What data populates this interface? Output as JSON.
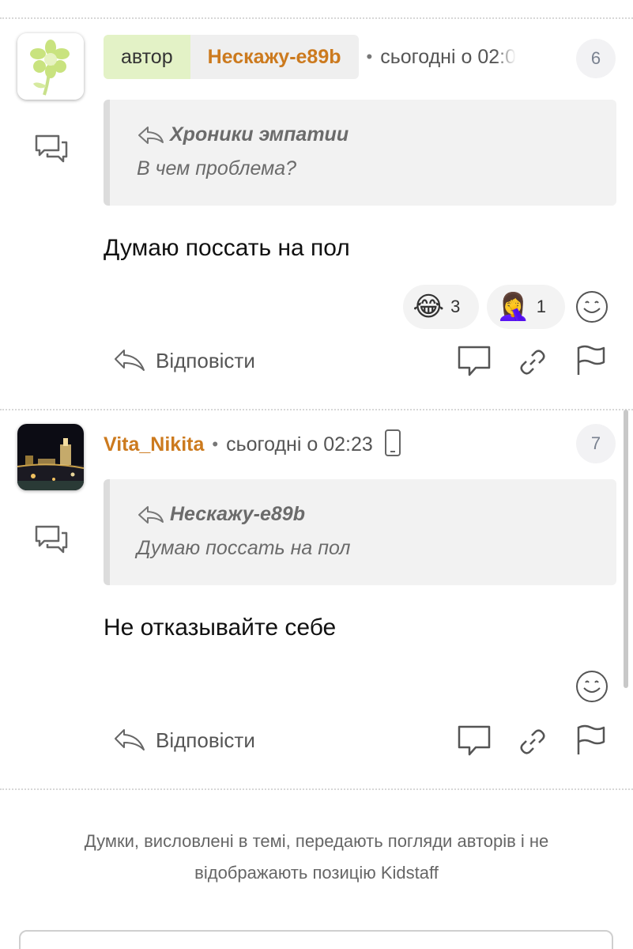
{
  "posts": [
    {
      "author_tag": "автор",
      "author": "Нескажу-e89b",
      "time": "сьогодні о 02:0",
      "number": "6",
      "quote": {
        "author": "Хроники эмпатии",
        "text": "В чем проблема?"
      },
      "body": "Думаю поссать на пол",
      "reactions": [
        {
          "emoji": "😂",
          "count": "3"
        },
        {
          "emoji": "🤦‍♀️",
          "count": "1"
        }
      ],
      "reply_label": "Відповісти"
    },
    {
      "author": "Vita_Nikita",
      "time": "сьогодні о 02:23",
      "number": "7",
      "quote": {
        "author": "Нескажу-e89b",
        "text": "Думаю поссать на пол"
      },
      "body": "Не отказывайте себе",
      "reply_label": "Відповісти"
    }
  ],
  "footer": {
    "disclaimer_line1": "Думки, висловлені в темі, передають погляди авторів і не",
    "disclaimer_line2": "відображають позицію Kidstaff"
  },
  "colors": {
    "author": "#cc7a1e",
    "author_tag_bg": "#e3f2c6",
    "quote_bg": "#f2f2f2"
  }
}
